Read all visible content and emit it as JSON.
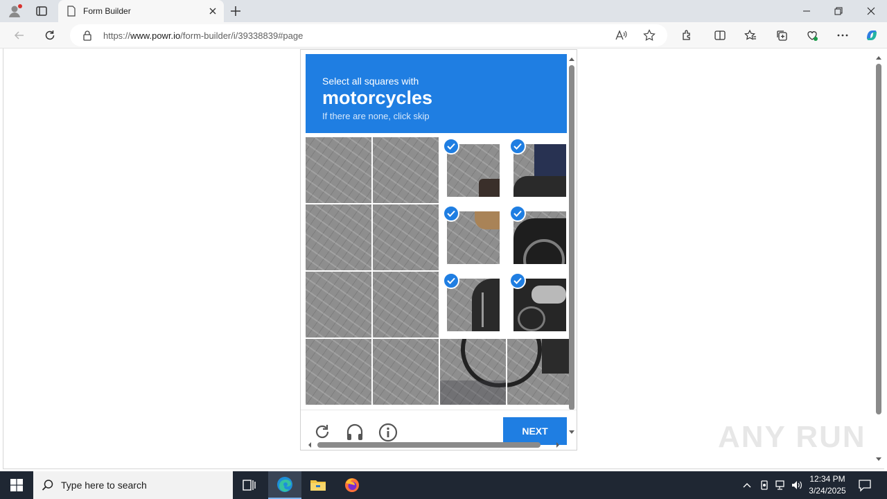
{
  "browser": {
    "tab_title": "Form Builder",
    "url_prefix": "https://",
    "url_host": "www.powr.io",
    "url_path": "/form-builder/i/39338839#page"
  },
  "captcha": {
    "instruction": "Select all squares with",
    "target": "motorcycles",
    "hint": "If there are none, click skip",
    "next_label": "NEXT",
    "selected_tiles": [
      [
        0,
        2
      ],
      [
        0,
        3
      ],
      [
        1,
        2
      ],
      [
        1,
        3
      ],
      [
        2,
        2
      ],
      [
        2,
        3
      ]
    ],
    "brand_color": "#1f7ee2"
  },
  "watermark": "ANY RUN",
  "taskbar": {
    "search_placeholder": "Type here to search",
    "time": "12:34 PM",
    "date": "3/24/2025"
  },
  "colors": {
    "taskbar": "#1f2733",
    "accent": "#1f7ee2"
  }
}
